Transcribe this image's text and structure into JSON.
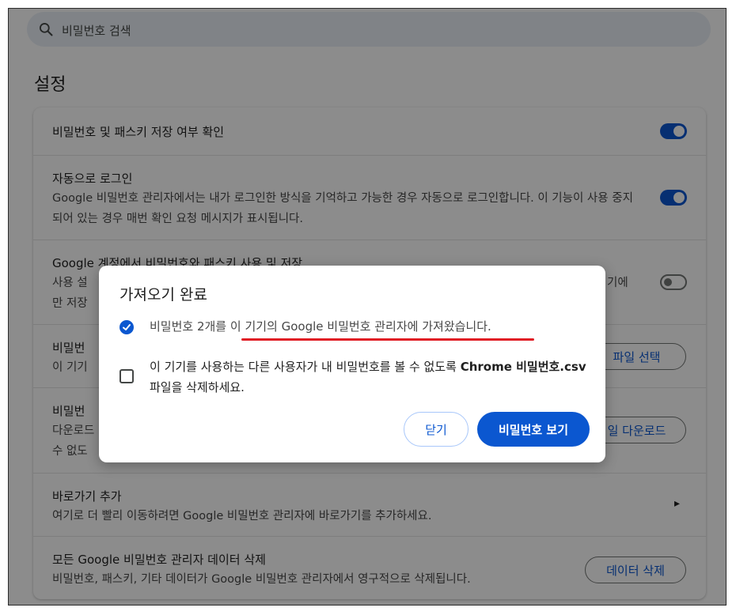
{
  "search": {
    "placeholder": "비밀번호 검색"
  },
  "section_title": "설정",
  "settings": {
    "offer_save": {
      "title": "비밀번호 및 패스키 저장 여부 확인",
      "toggle_on": true
    },
    "auto_signin": {
      "title": "자동으로 로그인",
      "desc": "Google 비밀번호 관리자에서는 내가 로그인한 방식을 기억하고 가능한 경우 자동으로 로그인합니다. 이 기능이 사용 중지되어 있는 경우 매번 확인 요청 메시지가 표시됩니다.",
      "toggle_on": true
    },
    "account_storage": {
      "title": "Google 계정에서 비밀번호와 패스키 사용 및 저장",
      "desc_start": "사용 설",
      "desc_end": "기에",
      "desc_line2": "만 저장",
      "toggle_on": false
    },
    "import": {
      "title": "비밀번",
      "desc": "이 기기",
      "button": "파일 선택"
    },
    "export": {
      "title": "비밀번",
      "desc_line1": "다운로드",
      "desc_line2": "수 없도",
      "button": "일 다운로드"
    },
    "shortcut": {
      "title": "바로가기 추가",
      "desc": "여기로 더 빨리 이동하려면 Google 비밀번호 관리자에 바로가기를 추가하세요."
    },
    "delete_all": {
      "title": "모든 Google 비밀번호 관리자 데이터 삭제",
      "desc": "비밀번호, 패스키, 기타 데이터가 Google 비밀번호 관리자에서 영구적으로 삭제됩니다.",
      "button": "데이터 삭제"
    }
  },
  "dialog": {
    "title": "가져오기 완료",
    "message1": "비밀번호 2개를 이 기기의 Google 비밀번호 관리자에 가져왔습니다.",
    "message2_prefix": "이 기기를 사용하는 다른 사용자가 내 비밀번호를 볼 수 없도록 ",
    "message2_bold": "Chrome 비밀번호.csv",
    "message2_suffix": " 파일을 삭제하세요.",
    "close_label": "닫기",
    "view_label": "비밀번호 보기"
  },
  "colors": {
    "accent": "#0b57d0",
    "annotation": "#e01b24"
  }
}
